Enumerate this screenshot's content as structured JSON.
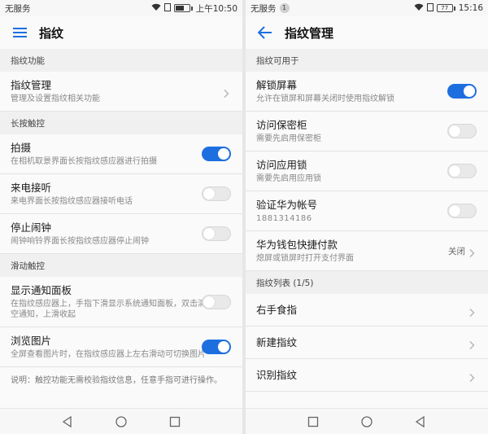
{
  "left": {
    "status": {
      "carrier": "无服务",
      "time": "上午10:50"
    },
    "title": "指纹",
    "sections": [
      {
        "header": "指纹功能",
        "items": [
          {
            "title": "指纹管理",
            "subtitle": "管理及设置指纹相关功能",
            "control": "chevron"
          }
        ]
      },
      {
        "header": "长按触控",
        "items": [
          {
            "title": "拍摄",
            "subtitle": "在相机取景界面长按指纹感应器进行拍摄",
            "control": "toggle",
            "on": true
          },
          {
            "title": "来电接听",
            "subtitle": "来电界面长按指纹感应器接听电话",
            "control": "toggle",
            "on": false
          },
          {
            "title": "停止闹钟",
            "subtitle": "闹钟响铃界面长按指纹感应器停止闹钟",
            "control": "toggle",
            "on": false
          }
        ]
      },
      {
        "header": "滑动触控",
        "items": [
          {
            "title": "显示通知面板",
            "subtitle": "在指纹感应器上，手指下滑显示系统通知面板，双击清空通知，上滑收起",
            "control": "toggle",
            "on": false
          },
          {
            "title": "浏览图片",
            "subtitle": "全屏查看图片时，在指纹感应器上左右滑动可切换图片",
            "control": "toggle",
            "on": true
          }
        ]
      }
    ],
    "note": "说明：触控功能无需校验指纹信息，任意手指可进行操作。"
  },
  "right": {
    "status": {
      "carrier": "无服务",
      "badge": "1",
      "battery": "77",
      "time": "15:16"
    },
    "title": "指纹管理",
    "sections": [
      {
        "header": "指纹可用于",
        "items": [
          {
            "title": "解锁屏幕",
            "subtitle": "允许在锁屏和屏幕关闭时使用指纹解锁",
            "control": "toggle",
            "on": true
          },
          {
            "title": "访问保密柜",
            "subtitle": "需要先启用保密柜",
            "control": "toggle",
            "on": false
          },
          {
            "title": "访问应用锁",
            "subtitle": "需要先启用应用锁",
            "control": "toggle",
            "on": false
          },
          {
            "title": "验证华为帐号",
            "subtitle": "1881314186",
            "control": "toggle",
            "on": false,
            "obscured": true
          },
          {
            "title": "华为钱包快捷付款",
            "subtitle": "熄屏或锁屏时打开支付界面",
            "control": "value",
            "value": "关闭"
          }
        ]
      },
      {
        "header": "指纹列表 (1/5)",
        "items": [
          {
            "title": "右手食指",
            "control": "chevron"
          },
          {
            "title": "新建指纹",
            "control": "chevron"
          },
          {
            "title": "识别指纹",
            "control": "chevron"
          }
        ]
      }
    ]
  },
  "colors": {
    "accent": "#1d6fe0",
    "toggle_off": "#e9e9e9",
    "header_bg": "#f0f0f0"
  }
}
